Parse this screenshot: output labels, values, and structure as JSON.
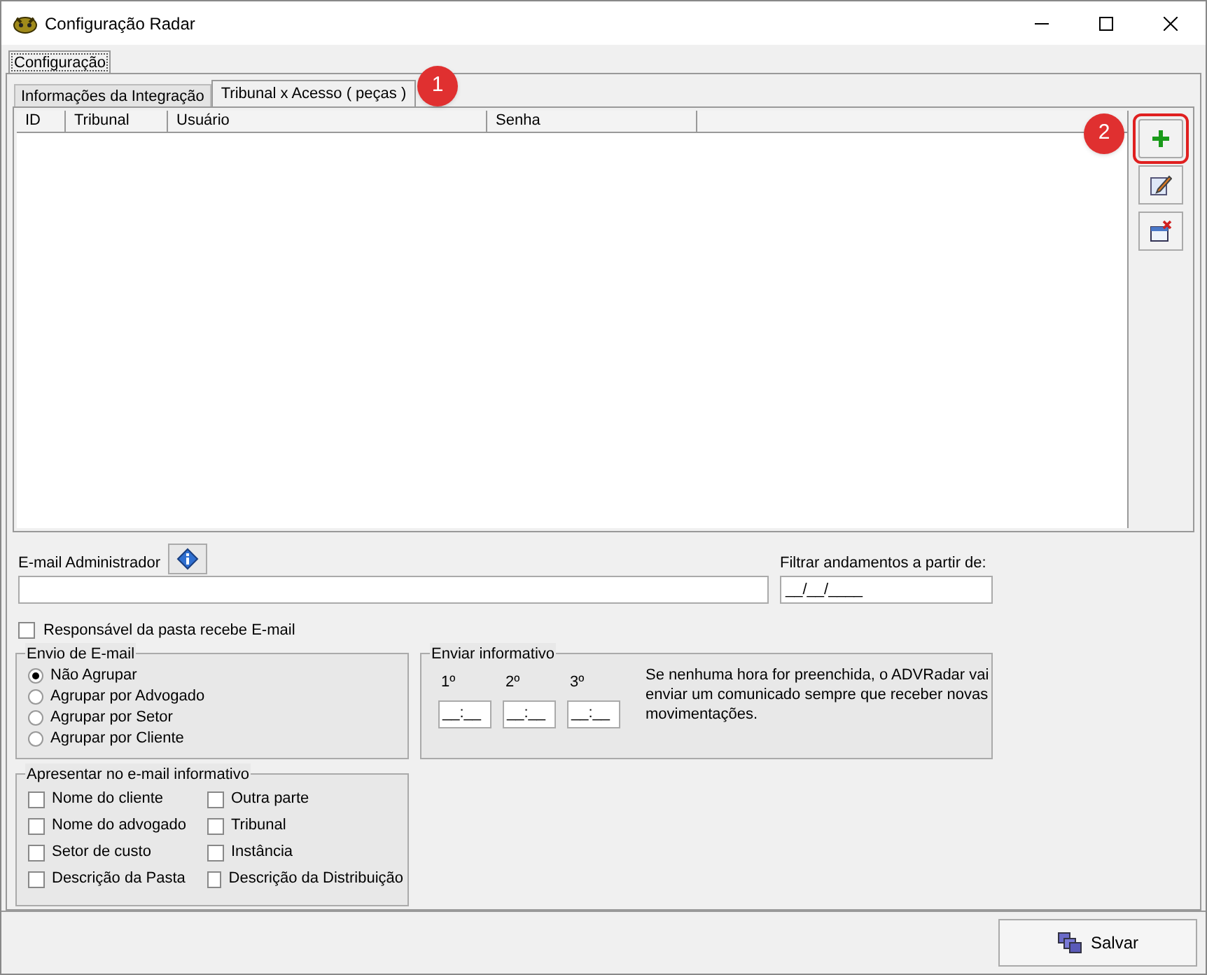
{
  "window": {
    "title": "Configuração Radar"
  },
  "outer_tabs": [
    {
      "label": "Configuração",
      "selected": true
    }
  ],
  "tabs": [
    {
      "label": "Informações da Integração",
      "selected": false
    },
    {
      "label": "Tribunal x Acesso ( peças )",
      "selected": true
    }
  ],
  "annotations": [
    {
      "label": "1"
    },
    {
      "label": "2"
    }
  ],
  "table": {
    "columns": [
      "ID",
      "Tribunal",
      "Usuário",
      "Senha"
    ]
  },
  "toolbar": [
    {
      "kind": "add",
      "highlighted": true
    },
    {
      "kind": "edit",
      "highlighted": false
    },
    {
      "kind": "delete",
      "highlighted": false
    }
  ],
  "email_admin": {
    "label": "E-mail Administrador"
  },
  "filter": {
    "label": "Filtrar andamentos a partir de:",
    "value": "__/__/____"
  },
  "responsible": {
    "label": "Responsável da pasta recebe E-mail",
    "checked": false
  },
  "envio": {
    "title": "Envio de E-mail",
    "options": [
      {
        "label": "Não Agrupar",
        "selected": true
      },
      {
        "label": "Agrupar por Advogado",
        "selected": false
      },
      {
        "label": "Agrupar por Setor",
        "selected": false
      },
      {
        "label": "Agrupar por Cliente",
        "selected": false
      }
    ]
  },
  "informativo": {
    "title": "Enviar informativo",
    "times": [
      {
        "label": "1º",
        "value": "__:__"
      },
      {
        "label": "2º",
        "value": "__:__"
      },
      {
        "label": "3º",
        "value": "__:__"
      }
    ],
    "note": "Se nenhuma hora for preenchida, o ADVRadar vai enviar um comunicado sempre que receber novas movimentações."
  },
  "apresentar": {
    "title": "Apresentar no e-mail informativo",
    "items": [
      {
        "label": "Nome do cliente",
        "checked": false
      },
      {
        "label": "Outra parte",
        "checked": false
      },
      {
        "label": "Nome do advogado",
        "checked": false
      },
      {
        "label": "Tribunal",
        "checked": false
      },
      {
        "label": "Setor de custo",
        "checked": false
      },
      {
        "label": "Instância",
        "checked": false
      },
      {
        "label": "Descrição da Pasta",
        "checked": false
      },
      {
        "label": "Descrição da Distribuição",
        "checked": false
      }
    ]
  },
  "save_button": {
    "label": "Salvar"
  }
}
